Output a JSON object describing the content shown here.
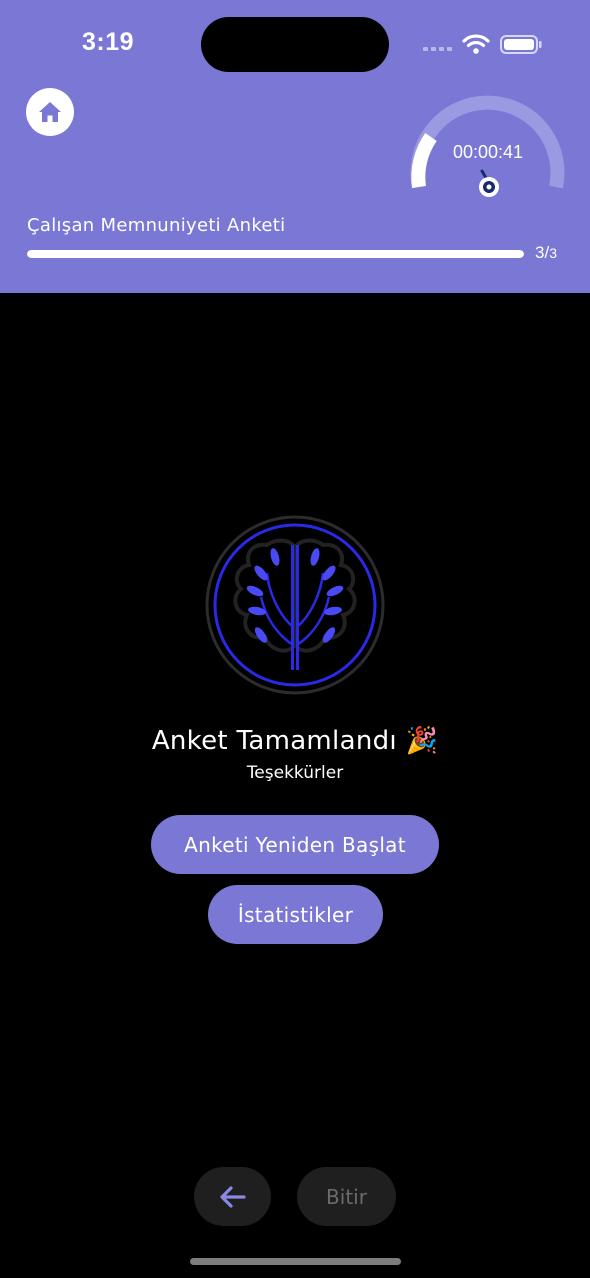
{
  "status_bar": {
    "time": "3:19"
  },
  "header": {
    "home_icon": "home-icon",
    "timer_text": "00:00:41",
    "survey_title": "Çalışan Memnuniyeti Anketi",
    "progress": {
      "current": "3",
      "separator": "/",
      "total": "3",
      "fraction": 1.0
    }
  },
  "main": {
    "logo_icon": "brain-tree-logo",
    "title": "Anket Tamamlandı 🎉",
    "subtitle": "Teşekkürler",
    "restart_label": "Anketi Yeniden Başlat",
    "stats_label": "İstatistikler"
  },
  "footer": {
    "back_icon": "arrow-left-icon",
    "finish_label": "Bitir"
  },
  "colors": {
    "accent": "#7a78d4",
    "background": "#000000",
    "nav_button": "#1f1f1f",
    "logo_blue": "#2a2ae6"
  }
}
